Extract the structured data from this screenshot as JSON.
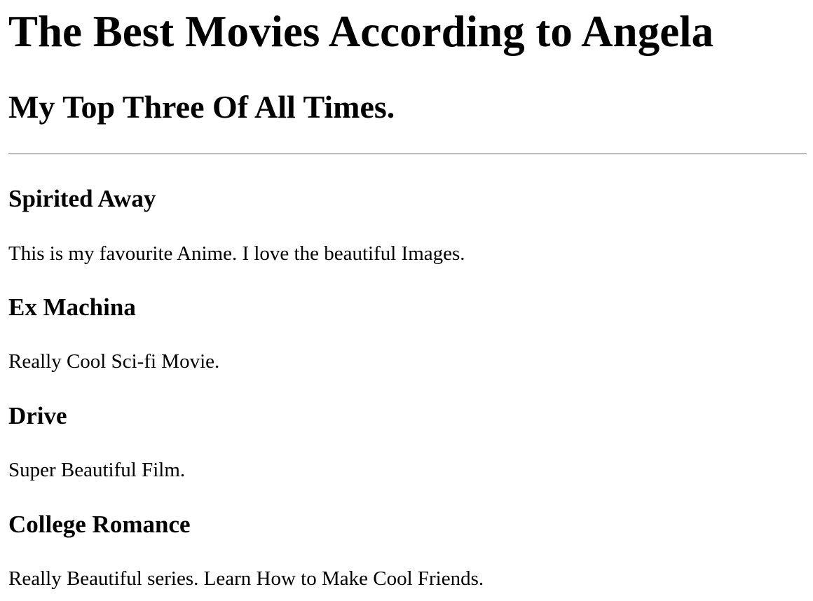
{
  "page": {
    "title": "The Best Movies According to Angela",
    "subtitle": "My Top Three Of All Times."
  },
  "movies": [
    {
      "title": "Spirited Away",
      "description": "This is my favourite Anime. I love the beautiful Images."
    },
    {
      "title": "Ex Machina",
      "description": "Really Cool Sci-fi Movie."
    },
    {
      "title": "Drive",
      "description": "Super Beautiful Film."
    },
    {
      "title": "College Romance",
      "description": "Really Beautiful series. Learn How to Make Cool Friends."
    }
  ]
}
